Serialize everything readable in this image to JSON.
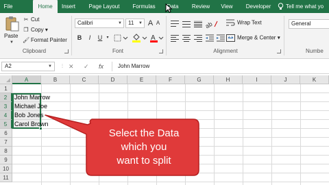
{
  "ribbon_tabs": [
    "File",
    "Home",
    "Insert",
    "Page Layout",
    "Formulas",
    "Data",
    "Review",
    "View",
    "Developer"
  ],
  "tell_me": "Tell me what yo",
  "clipboard": {
    "paste": "Paste",
    "cut": "Cut",
    "copy": "Copy",
    "format_painter": "Format Painter",
    "group_label": "Clipboard"
  },
  "font": {
    "name": "Calibri",
    "size": "11",
    "grow": "A",
    "shrink": "A",
    "bold": "B",
    "italic": "I",
    "underline": "U",
    "group_label": "Font"
  },
  "alignment": {
    "wrap_text": "Wrap Text",
    "merge_center": "Merge & Center",
    "group_label": "Alignment"
  },
  "number": {
    "format": "General",
    "group_label": "Numbe"
  },
  "formula_bar": {
    "name_box": "A2",
    "cancel": "✕",
    "enter": "✓",
    "fx": "fx",
    "content": "John Marrow"
  },
  "columns": [
    "A",
    "B",
    "C",
    "D",
    "E",
    "F",
    "G",
    "H",
    "I",
    "J",
    "K"
  ],
  "rows": [
    "1",
    "2",
    "3",
    "4",
    "5",
    "6",
    "7",
    "8",
    "9",
    "10",
    "11"
  ],
  "cells": {
    "A2": "John Marrow",
    "A3": "Michael Joe",
    "A4": "Bob Jones",
    "A5": "Carol Brown"
  },
  "callout": {
    "line1": "Select the Data",
    "line2": "which you",
    "line3": "want to split"
  },
  "colors": {
    "excel_green": "#217346",
    "callout_red": "#e03a3a"
  }
}
